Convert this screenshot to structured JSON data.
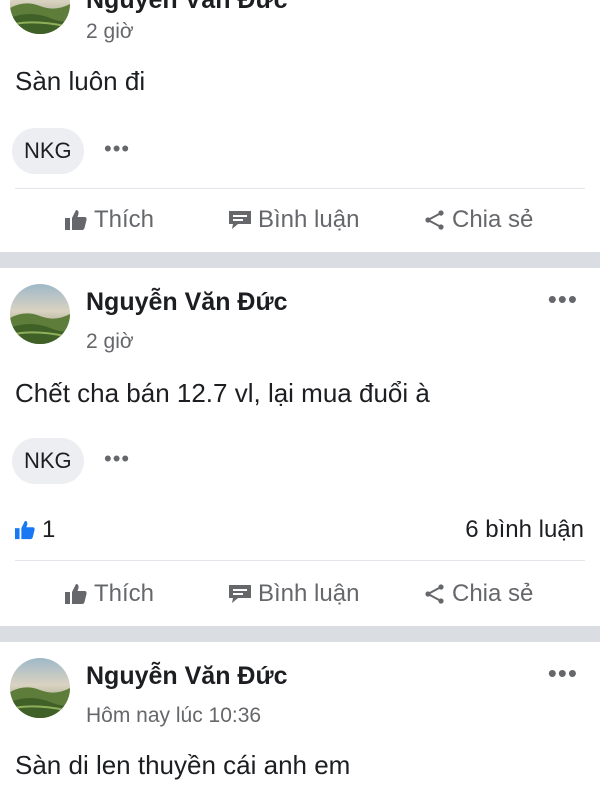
{
  "posts": [
    {
      "author": "Nguyễn Văn Đức",
      "time": "2 giờ",
      "content": "Sàn luôn đi",
      "tag": "NKG",
      "actions": {
        "like": "Thích",
        "comment": "Bình luận",
        "share": "Chia sẻ"
      }
    },
    {
      "author": "Nguyễn Văn Đức",
      "time": "2 giờ",
      "content": "Chết cha bán 12.7 vl, lại mua đuổi à",
      "tag": "NKG",
      "reactions": {
        "like_count": "1",
        "comment_count": "6 bình luận"
      },
      "actions": {
        "like": "Thích",
        "comment": "Bình luận",
        "share": "Chia sẻ"
      }
    },
    {
      "author": "Nguyễn Văn Đức",
      "time": "Hôm nay lúc 10:36",
      "content": "Sàn di len thuyền cái anh em"
    }
  ],
  "icons": {
    "more": "more-options-icon",
    "like": "thumbs-up-icon",
    "comment": "comment-icon",
    "share": "share-icon"
  },
  "colors": {
    "like_reaction": "#1877f2",
    "secondary_text": "#65676b",
    "separator": "#dadde1",
    "tag_background": "#eceef1"
  }
}
